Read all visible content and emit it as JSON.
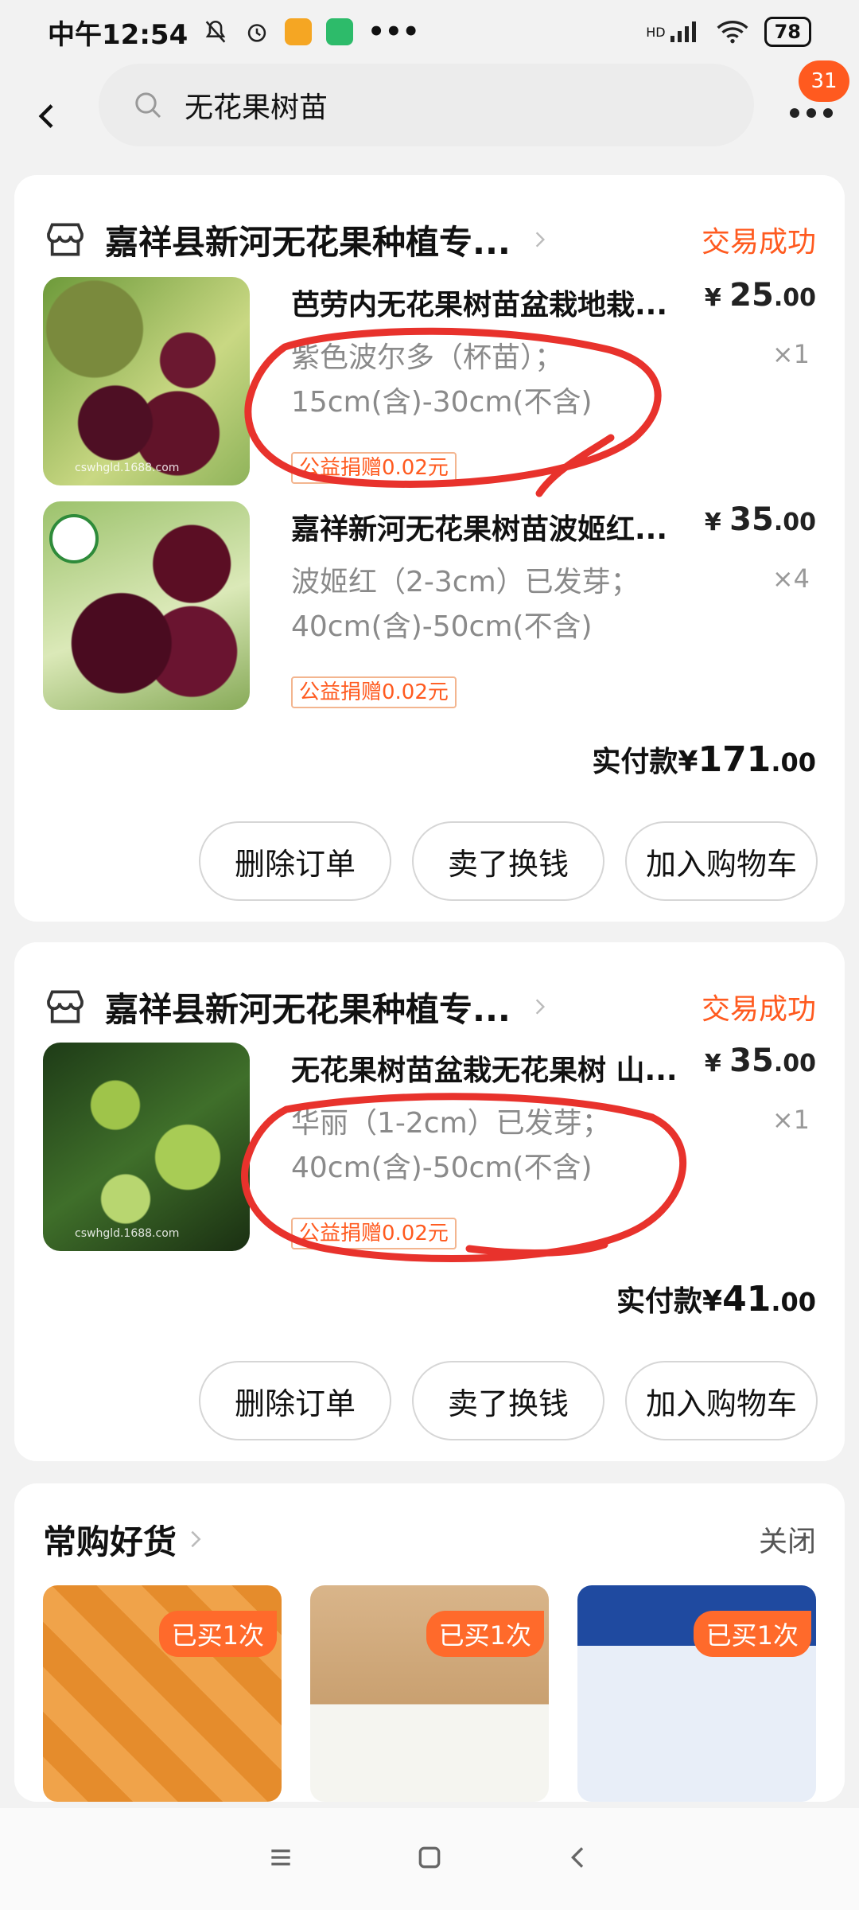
{
  "status_bar": {
    "time": "中午12:54",
    "signal_label": "HD",
    "battery": "78"
  },
  "header": {
    "search_query": "无花果树苗",
    "badge_count": "31"
  },
  "orders": [
    {
      "shop_name": "嘉祥县新河无花果种植专...",
      "status": "交易成功",
      "items": [
        {
          "title": "芭劳内无花果树苗盆栽地栽...",
          "price_symbol": "¥",
          "price_int": "25",
          "price_dec": ".00",
          "spec_line1": "紫色波尔多（杯苗）；",
          "spec_line2": "15cm(含)-30cm(不含)",
          "qty": "×1",
          "donate": "公益捐赠0.02元",
          "watermark": "cswhgld.1688.com"
        },
        {
          "title": "嘉祥新河无花果树苗波姬红...",
          "price_symbol": "¥",
          "price_int": "35",
          "price_dec": ".00",
          "spec_line1": "波姬红（2-3cm）已发芽；",
          "spec_line2": "40cm(含)-50cm(不含)",
          "qty": "×4",
          "donate": "公益捐赠0.02元"
        }
      ],
      "total_label": "实付款",
      "total_symbol": "¥",
      "total_int": "171",
      "total_dec": ".00"
    },
    {
      "shop_name": "嘉祥县新河无花果种植专...",
      "status": "交易成功",
      "items": [
        {
          "title": "无花果树苗盆栽无花果树 山...",
          "price_symbol": "¥",
          "price_int": "35",
          "price_dec": ".00",
          "spec_line1": "华丽（1-2cm）已发芽；",
          "spec_line2": "40cm(含)-50cm(不含)",
          "qty": "×1",
          "donate": "公益捐赠0.02元",
          "watermark": "cswhgld.1688.com"
        }
      ],
      "total_label": "实付款",
      "total_symbol": "¥",
      "total_int": "41",
      "total_dec": ".00"
    }
  ],
  "buttons": {
    "delete": "删除订单",
    "resell": "卖了换钱",
    "add_cart": "加入购物车"
  },
  "frequent": {
    "title": "常购好货",
    "close": "关闭",
    "items": [
      {
        "badge": "已买1次"
      },
      {
        "badge": "已买1次"
      },
      {
        "badge": "已买1次"
      }
    ]
  },
  "colors": {
    "accent": "#ff5a1f",
    "annotation": "#e8322c"
  }
}
